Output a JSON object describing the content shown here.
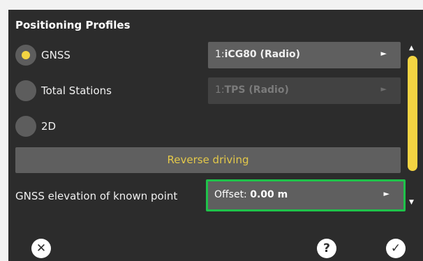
{
  "title": "Positioning Profiles",
  "profiles": [
    {
      "label": "GNSS",
      "selected": true,
      "combo_prefix": "1:",
      "combo_value": "iCG80 (Radio)",
      "enabled": true
    },
    {
      "label": "Total Stations",
      "selected": false,
      "combo_prefix": "1:",
      "combo_value": "TPS (Radio)",
      "enabled": false
    },
    {
      "label": "2D",
      "selected": false
    }
  ],
  "reverse_button": "Reverse driving",
  "elevation": {
    "label": "GNSS elevation of known point",
    "prefix": "Offset:",
    "value": "0.00 m"
  },
  "icons": {
    "cancel": "close-circle-icon",
    "help": "help-circle-icon",
    "confirm": "check-circle-icon"
  },
  "colors": {
    "accent": "#f4d442",
    "highlight": "#1fc24a",
    "panel": "#2c2c2c",
    "control": "#5f5f5f"
  }
}
